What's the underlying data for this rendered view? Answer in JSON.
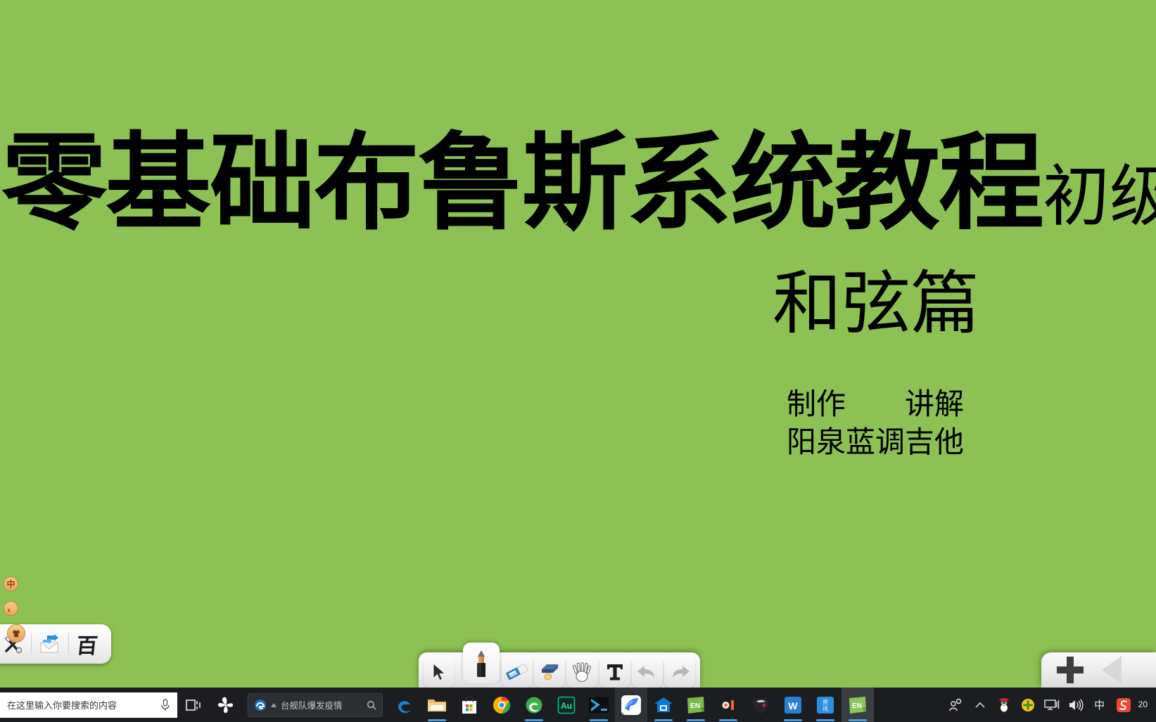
{
  "slide": {
    "background_color": "#8dc153",
    "title_main": "零基础布鲁斯系统教程",
    "title_suffix": "初级",
    "title_line2": "和弦篇",
    "credits": "制作　　讲解\n阳泉蓝调吉他"
  },
  "ime_floating": {
    "language_mode": "中",
    "punctuation_mode": "，"
  },
  "ime_panel": {
    "items": [
      {
        "name": "toolbox-icon",
        "label": "工具箱"
      },
      {
        "name": "mail-send-icon",
        "label": "快速发送"
      },
      {
        "name": "baidu-logo",
        "label": "百"
      }
    ]
  },
  "tool_dock": {
    "tools": [
      {
        "name": "select-arrow-icon",
        "label": "选择",
        "selected": false
      },
      {
        "name": "pencil-icon",
        "label": "画笔",
        "selected": true
      },
      {
        "name": "eraser-icon",
        "label": "橡皮擦",
        "selected": false
      },
      {
        "name": "shape-icon",
        "label": "形状",
        "selected": false
      },
      {
        "name": "hand-icon",
        "label": "手型",
        "selected": false
      },
      {
        "name": "text-tool-icon",
        "label": "T",
        "selected": false
      },
      {
        "name": "undo-icon",
        "label": "撤销",
        "selected": false
      },
      {
        "name": "redo-icon",
        "label": "重做",
        "selected": false
      }
    ]
  },
  "plus_dock": {
    "add_label": "+",
    "collapse_label": "◀"
  },
  "taskbar": {
    "search_placeholder": "在这里输入你要搜索的内容",
    "microphone_icon": "mic-icon",
    "task_view_icon": "task-view-icon",
    "news_headline": "台舰队爆发疫情",
    "news_browser_icon": "ie-icon",
    "news_search_icon": "search-icon",
    "apps": [
      {
        "name": "edge-icon",
        "label": "Microsoft Edge",
        "state": "idle"
      },
      {
        "name": "file-explorer-icon",
        "label": "文件资源管理器",
        "state": "running"
      },
      {
        "name": "microsoft-store-icon",
        "label": "Microsoft Store",
        "state": "idle"
      },
      {
        "name": "chrome-icon",
        "label": "Google Chrome",
        "state": "idle"
      },
      {
        "name": "green-browser-icon",
        "label": "浏览器",
        "state": "running"
      },
      {
        "name": "adobe-audition-icon",
        "label": "Au",
        "state": "idle"
      },
      {
        "name": "powershell-icon",
        "label": "PowerShell",
        "state": "running"
      },
      {
        "name": "blue-bird-icon",
        "label": "希沃白板",
        "state": "focus"
      },
      {
        "name": "education-home-icon",
        "label": "教育之家",
        "state": "running"
      },
      {
        "name": "endnote-icon",
        "label": "EN",
        "state": "running"
      },
      {
        "name": "media-player-icon",
        "label": "播放器",
        "state": "running"
      },
      {
        "name": "guitar-pick-icon",
        "label": "吉他软件",
        "state": "idle"
      },
      {
        "name": "wps-icon",
        "label": "W",
        "state": "running"
      },
      {
        "name": "news-app-icon",
        "label": "资讯",
        "state": "running"
      },
      {
        "name": "endnote2-icon",
        "label": "EN",
        "state": "running"
      }
    ],
    "tray": [
      {
        "name": "people-icon",
        "glyph": "👥"
      },
      {
        "name": "chevron-up-icon",
        "glyph": "^"
      },
      {
        "name": "qq-penguin-icon",
        "glyph": "QQ"
      },
      {
        "name": "shield-icon",
        "glyph": "✛"
      },
      {
        "name": "network-icon",
        "glyph": "🖳"
      },
      {
        "name": "volume-icon",
        "glyph": "🔊"
      },
      {
        "name": "ime-mode-icon",
        "glyph": "中"
      },
      {
        "name": "sogou-icon",
        "glyph": "S"
      }
    ],
    "clock": "20"
  }
}
